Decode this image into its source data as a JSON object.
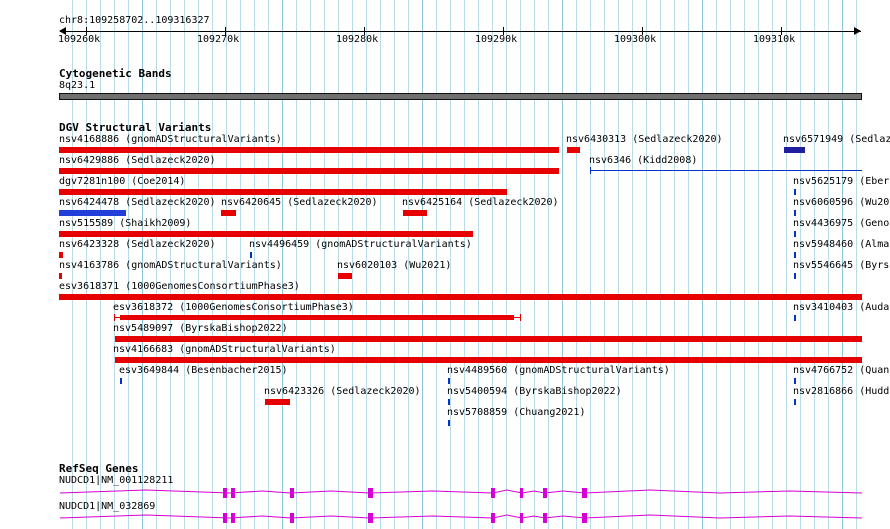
{
  "ruler": {
    "region": "chr8:109258702..109316327",
    "ticks": [
      "109260k",
      "109270k",
      "109280k",
      "109290k",
      "109300k",
      "109310k"
    ]
  },
  "cytogenetic": {
    "title": "Cytogenetic Bands",
    "band_name": "8q23.1"
  },
  "dgv": {
    "title": "DGV Structural Variants",
    "features": [
      {
        "label": "nsv4168886 (gnomADStructuralVariants)",
        "color": "#e60000"
      },
      {
        "label": "nsv6430313 (Sedlazeck2020)",
        "color": "#e60000"
      },
      {
        "label": "nsv6571949 (Sedlaz",
        "color": "#1f1f9f"
      },
      {
        "label": "nsv6429886 (Sedlazeck2020)",
        "color": "#e60000"
      },
      {
        "label": "nsv6346 (Kidd2008)",
        "color": "#0033cc"
      },
      {
        "label": "dgv7281n100 (Coe2014)",
        "color": "#e60000"
      },
      {
        "label": "nsv5625179 (Eber",
        "color": "#0033cc"
      },
      {
        "label": "nsv6424478 (Sedlazeck2020)",
        "color": "#1f3fd8"
      },
      {
        "label": "nsv6420645 (Sedlazeck2020)",
        "color": "#e60000"
      },
      {
        "label": "nsv6425164 (Sedlazeck2020)",
        "color": "#e60000"
      },
      {
        "label": "nsv6060596 (Wu20",
        "color": "#0033cc"
      },
      {
        "label": "nsv515589 (Shaikh2009)",
        "color": "#e60000"
      },
      {
        "label": "nsv4436975 (Geno",
        "color": "#0033cc"
      },
      {
        "label": "nsv6423328 (Sedlazeck2020)",
        "color": "#e60000"
      },
      {
        "label": "nsv4496459 (gnomADStructuralVariants)",
        "color": "#0033cc"
      },
      {
        "label": "nsv5948460 (Alma",
        "color": "#0033cc"
      },
      {
        "label": "nsv4163786 (gnomADStructuralVariants)",
        "color": "#e60000"
      },
      {
        "label": "nsv6020103 (Wu2021)",
        "color": "#e60000"
      },
      {
        "label": "nsv5546645 (Byrs",
        "color": "#0033cc"
      },
      {
        "label": "esv3618371 (1000GenomesConsortiumPhase3)",
        "color": "#e60000"
      },
      {
        "label": "esv3618372 (1000GenomesConsortiumPhase3)",
        "color": "#e60000"
      },
      {
        "label": "nsv3410403 (Auda",
        "color": "#0033cc"
      },
      {
        "label": "nsv5489097 (ByrskaBishop2022)",
        "color": "#e60000"
      },
      {
        "label": "nsv4166683 (gnomADStructuralVariants)",
        "color": "#e60000"
      },
      {
        "label": "esv3649844 (Besenbacher2015)",
        "color": "#0033cc"
      },
      {
        "label": "nsv4489560 (gnomADStructuralVariants)",
        "color": "#0033cc"
      },
      {
        "label": "nsv4766752 (Quan",
        "color": "#0033cc"
      },
      {
        "label": "nsv6423326 (Sedlazeck2020)",
        "color": "#e60000"
      },
      {
        "label": "nsv5400594 (ByrskaBishop2022)",
        "color": "#0033cc"
      },
      {
        "label": "nsv2816866 (Hudd",
        "color": "#0033cc"
      },
      {
        "label": "nsv5708859 (Chuang2021)",
        "color": "#0033cc"
      }
    ]
  },
  "refseq": {
    "title": "RefSeq Genes",
    "gene_color": "#d600d6",
    "transcripts": [
      {
        "label": "NUDCD1|NM_001128211"
      },
      {
        "label": "NUDCD1|NM_032869"
      }
    ]
  }
}
